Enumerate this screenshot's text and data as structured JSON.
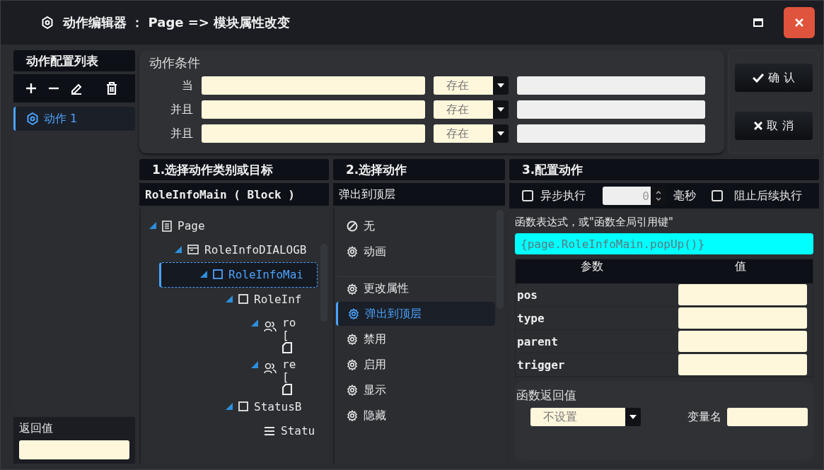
{
  "window": {
    "title": "动作编辑器 ： Page => 模块属性改变"
  },
  "action_list": {
    "title": "动作配置列表",
    "items": [
      {
        "label": "动作 1",
        "selected": true
      }
    ]
  },
  "return_value": {
    "label": "返回值"
  },
  "conditions": {
    "title": "动作条件",
    "rows": [
      {
        "label": "当",
        "operator": "存在"
      },
      {
        "label": "并且",
        "operator": "存在"
      },
      {
        "label": "并且",
        "operator": "存在"
      }
    ]
  },
  "buttons": [
    {
      "label": "确 认",
      "kind": "confirm"
    },
    {
      "label": "取 消",
      "kind": "cancel"
    }
  ],
  "target_panel": {
    "title": "1.选择动作类别或目标",
    "current": "RoleInfoMain ( Block )",
    "tree": [
      {
        "label": "Page",
        "kind": "page",
        "expanded": true,
        "selected": false,
        "children": [
          {
            "label": "RoleInfoDIALOGB",
            "kind": "window",
            "expanded": true,
            "selected": false,
            "children": [
              {
                "label": "RoleInfoMai",
                "kind": "block",
                "expanded": true,
                "selected": true,
                "children": [
                  {
                    "label": "RoleInf",
                    "kind": "block",
                    "expanded": true,
                    "selected": false,
                    "children": [
                      {
                        "label": "ro",
                        "sub": "[",
                        "kind": "users",
                        "expanded": true,
                        "selected": false
                      },
                      {
                        "label": "re",
                        "sub": "[",
                        "kind": "users",
                        "expanded": true,
                        "selected": false
                      }
                    ]
                  },
                  {
                    "label": "StatusB",
                    "kind": "block",
                    "expanded": true,
                    "selected": false,
                    "children": [
                      {
                        "label": "Statu",
                        "kind": "list",
                        "selected": false
                      }
                    ]
                  }
                ]
              }
            ]
          }
        ]
      }
    ]
  },
  "action_panel": {
    "title": "2.选择动作",
    "current": "弹出到顶层",
    "items": [
      {
        "label": "无",
        "kind": "none",
        "selected": false,
        "divider_before": false
      },
      {
        "label": "动画",
        "kind": "action",
        "selected": false,
        "divider_before": false
      },
      {
        "label": "更改属性",
        "kind": "action",
        "selected": false,
        "divider_before": true
      },
      {
        "label": "弹出到顶层",
        "kind": "action",
        "selected": true,
        "divider_before": false
      },
      {
        "label": "禁用",
        "kind": "action",
        "selected": false,
        "divider_before": false
      },
      {
        "label": "启用",
        "kind": "action",
        "selected": false,
        "divider_before": false
      },
      {
        "label": "显示",
        "kind": "action",
        "selected": false,
        "divider_before": false
      },
      {
        "label": "隐藏",
        "kind": "action",
        "selected": false,
        "divider_before": false
      }
    ]
  },
  "config_panel": {
    "title": "3.配置动作",
    "async": {
      "label": "异步执行",
      "checked": false
    },
    "delay": {
      "value": "0",
      "unit": "毫秒"
    },
    "stop": {
      "label": "阻止后续执行",
      "checked": false
    },
    "expression": {
      "label": "函数表达式，或\"函数全局引用键\"",
      "placeholder": "{page.RoleInfoMain.popUp()}"
    },
    "params": {
      "columns": [
        "参数",
        "值"
      ],
      "rows": [
        {
          "name": "pos"
        },
        {
          "name": "type"
        },
        {
          "name": "parent"
        },
        {
          "name": "trigger"
        }
      ]
    },
    "result": {
      "title": "函数返回值",
      "mode": "不设置",
      "variable_label": "变量名"
    }
  }
}
